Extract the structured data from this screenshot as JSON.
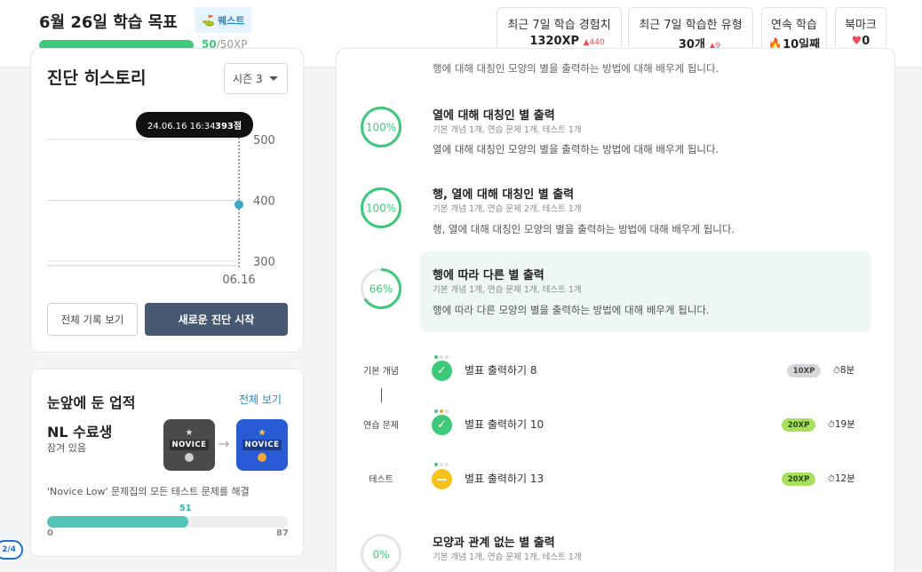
{
  "header": {
    "goal_title": "6월 26일 학습 목표",
    "quest_label": "퀘스트",
    "goal_xp_current": "50",
    "goal_xp_total": "/50XP",
    "goal_progress": 1.0,
    "stats": [
      {
        "label": "최근 7일 학습 경험치",
        "value": "1320XP",
        "delta": "▲440"
      },
      {
        "label": "최근 7일 학습한 유형",
        "value": "30개",
        "delta": "▲9"
      },
      {
        "label": "연속 학습",
        "icon": "🔥",
        "value": "10일째"
      },
      {
        "label": "북마크",
        "icon": "♥",
        "value": "0"
      }
    ]
  },
  "diagnosis": {
    "title": "진단 히스토리",
    "season": "시즌 3",
    "tooltip_date": "24.06.16 16:34",
    "tooltip_score": "393점",
    "btn_all": "전체 기록 보기",
    "btn_new": "새로운 진단 시작"
  },
  "chart_data": {
    "type": "scatter",
    "x": [
      "06.16"
    ],
    "y": [
      393
    ],
    "ylim": [
      300,
      500
    ],
    "yticks": [
      "500",
      "400",
      "300"
    ],
    "xticks": [
      "06.16"
    ],
    "grid": true
  },
  "achievement": {
    "title": "눈앞에 둔 업적",
    "link": "전체 보기",
    "name": "NL 수료생",
    "status": "잠겨 있음",
    "badge_text": "NOVICE",
    "description": "'Novice Low' 문제집의 모든 테스트 문제를 해결",
    "current": "51",
    "min": "0",
    "max": "87",
    "progress": 0.586
  },
  "page_indicator": "2/4",
  "main": {
    "cut_text": "행에 대해 대칭인 모양의 별을 출력하는 방법에 대해 배우게 됩니다.",
    "lessons": [
      {
        "percent": 100,
        "percent_label": "100%",
        "title": "열에 대해 대칭인 별 출력",
        "meta": "기본 개념 1개, 연습 문제 1개, 테스트 1개",
        "desc": "열에 대해 대칭인 모양의 별을 출력하는 방법에 대해 배우게 됩니다."
      },
      {
        "percent": 100,
        "percent_label": "100%",
        "title": "행, 열에 대해 대칭인 별 출력",
        "meta": "기본 개념 1개, 연습 문제 2개, 테스트 1개",
        "desc": "행, 열에 대해 대칭인 모양의 별을 출력하는 방법에 대해 배우게 됩니다."
      },
      {
        "percent": 66,
        "percent_label": "66%",
        "title": "행에 따라 다른 별 출력",
        "meta": "기본 개념 1개, 연습 문제 1개, 테스트 1개",
        "desc": "행에 따라 다른 모양의 별을 출력하는 방법에 대해 배우게 됩니다."
      },
      {
        "percent": 0,
        "percent_label": "0%",
        "title": "모양과 관계 없는 별 출력",
        "meta": "기본 개념 1개, 연습 문제 1개, 테스트 1개",
        "desc": ""
      }
    ],
    "steps": [
      {
        "type": "기본 개념",
        "name": "별표 출력하기 8",
        "xp": "10XP",
        "time": "8분",
        "status": "done"
      },
      {
        "type": "연습 문제",
        "name": "별표 출력하기 10",
        "xp": "20XP",
        "time": "19분",
        "status": "done"
      },
      {
        "type": "테스트",
        "name": "별표 출력하기 13",
        "xp": "20XP",
        "time": "12분",
        "status": "in-progress"
      }
    ]
  },
  "colors": {
    "green": "#3ec97a",
    "teal": "#54c4b8",
    "blue": "#1e88c9",
    "navy": "#485872",
    "yellow": "#f9c21b",
    "red": "#ef4b4b"
  }
}
